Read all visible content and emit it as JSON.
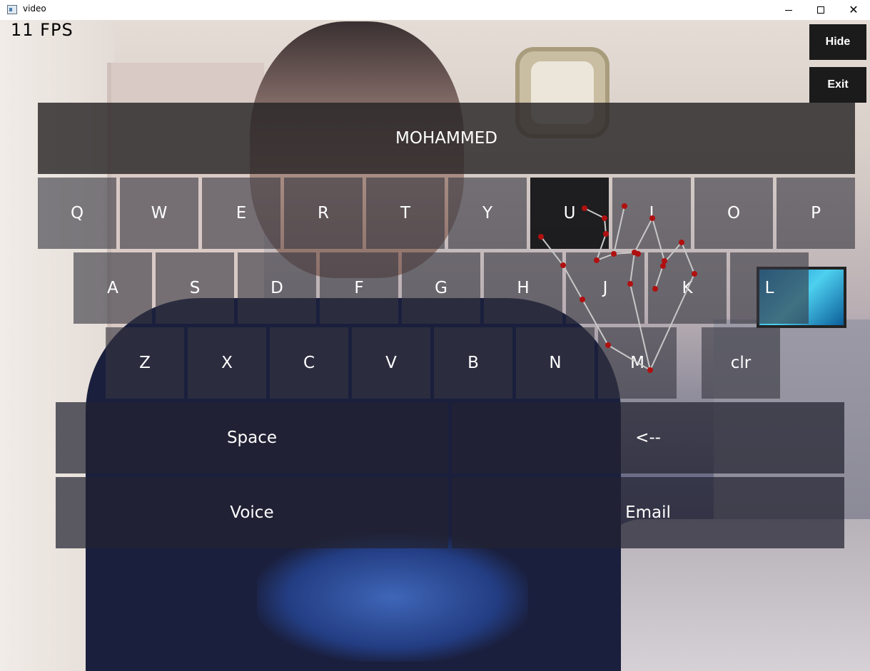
{
  "window": {
    "title": "video",
    "controls": {
      "minimize": "minimize-icon",
      "maximize": "maximize-icon",
      "close": "✕"
    }
  },
  "overlay": {
    "fps_label": "11 FPS",
    "hide_label": "Hide",
    "exit_label": "Exit",
    "typed_text": "MOHAMMED"
  },
  "keyboard": {
    "row1": [
      "Q",
      "W",
      "E",
      "R",
      "T",
      "Y",
      "U",
      "I",
      "O",
      "P"
    ],
    "row2": [
      "A",
      "S",
      "D",
      "F",
      "G",
      "H",
      "J",
      "K",
      "L"
    ],
    "row3": [
      "Z",
      "X",
      "C",
      "V",
      "B",
      "N",
      "M",
      "clr"
    ],
    "space_label": "Space",
    "backspace_label": "<--",
    "voice_label": "Voice",
    "email_label": "Email",
    "active_key": "U"
  },
  "colors": {
    "key_bg": "#37374199",
    "active_key_bg": "#141416",
    "landmark_dot": "#b01010",
    "landmark_line": "#c8c8c8"
  }
}
